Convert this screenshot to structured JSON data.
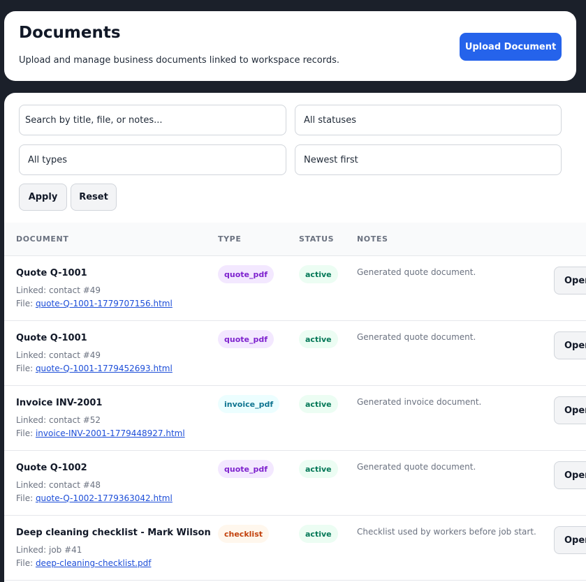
{
  "header": {
    "title": "Documents",
    "subtitle": "Upload and manage business documents linked to workspace records.",
    "upload_label": "Upload Document"
  },
  "filters": {
    "search_placeholder": "Search by title, file, or notes...",
    "status_value": "All statuses",
    "type_value": "All types",
    "sort_value": "Newest first",
    "apply_label": "Apply",
    "reset_label": "Reset"
  },
  "table": {
    "columns": [
      "DOCUMENT",
      "TYPE",
      "STATUS",
      "NOTES"
    ],
    "rows": [
      {
        "title": "Quote Q-1001",
        "linked": "Linked: contact #49",
        "file_prefix": "File: ",
        "file": "quote-Q-1001-1779707156.html",
        "type": "quote_pdf",
        "status": "active",
        "notes": "Generated quote document.",
        "action": "Open"
      },
      {
        "title": "Quote Q-1001",
        "linked": "Linked: contact #49",
        "file_prefix": "File: ",
        "file": "quote-Q-1001-1779452693.html",
        "type": "quote_pdf",
        "status": "active",
        "notes": "Generated quote document.",
        "action": "Open"
      },
      {
        "title": "Invoice INV-2001",
        "linked": "Linked: contact #52",
        "file_prefix": "File: ",
        "file": "invoice-INV-2001-1779448927.html",
        "type": "invoice_pdf",
        "status": "active",
        "notes": "Generated invoice document.",
        "action": "Open"
      },
      {
        "title": "Quote Q-1002",
        "linked": "Linked: contact #48",
        "file_prefix": "File: ",
        "file": "quote-Q-1002-1779363042.html",
        "type": "quote_pdf",
        "status": "active",
        "notes": "Generated quote document.",
        "action": "Open"
      },
      {
        "title": "Deep cleaning checklist - Mark Wilson",
        "linked": "Linked: job #41",
        "file_prefix": "File: ",
        "file": "deep-cleaning-checklist.pdf",
        "type": "checklist",
        "status": "active",
        "notes": "Checklist used by workers before job start.",
        "action": "Open"
      }
    ]
  },
  "colors": {
    "page_bg": "#1b202a",
    "accent": "#2563eb",
    "quote_pdf_bg": "#f3e8ff",
    "quote_pdf_fg": "#7e22ce",
    "invoice_pdf_bg": "#ecfeff",
    "invoice_pdf_fg": "#0e7490",
    "checklist_bg": "#fff7ed",
    "checklist_fg": "#c2410c",
    "active_bg": "#ecfdf3",
    "active_fg": "#047857"
  }
}
